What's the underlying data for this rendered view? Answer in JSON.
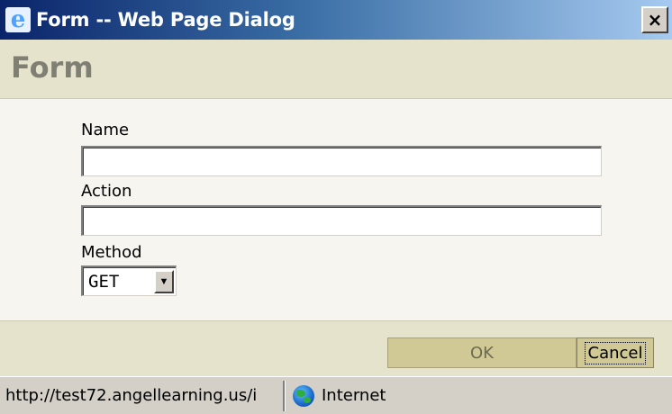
{
  "window": {
    "title": "Form -- Web Page Dialog",
    "icon": "ie-icon",
    "close_label": "×"
  },
  "header": {
    "title": "Form"
  },
  "form": {
    "name_label": "Name",
    "name_value": "",
    "action_label": "Action",
    "action_value": "",
    "method_label": "Method",
    "method_value": "GET"
  },
  "buttons": {
    "ok_label": "OK",
    "cancel_label": "Cancel"
  },
  "statusbar": {
    "url": "http://test72.angellearning.us/i",
    "zone_icon": "globe-icon",
    "zone_label": "Internet"
  },
  "colors": {
    "titlebar": "#0a246a",
    "header_bg": "#e6e3cd",
    "button_bg": "#d0c995"
  }
}
